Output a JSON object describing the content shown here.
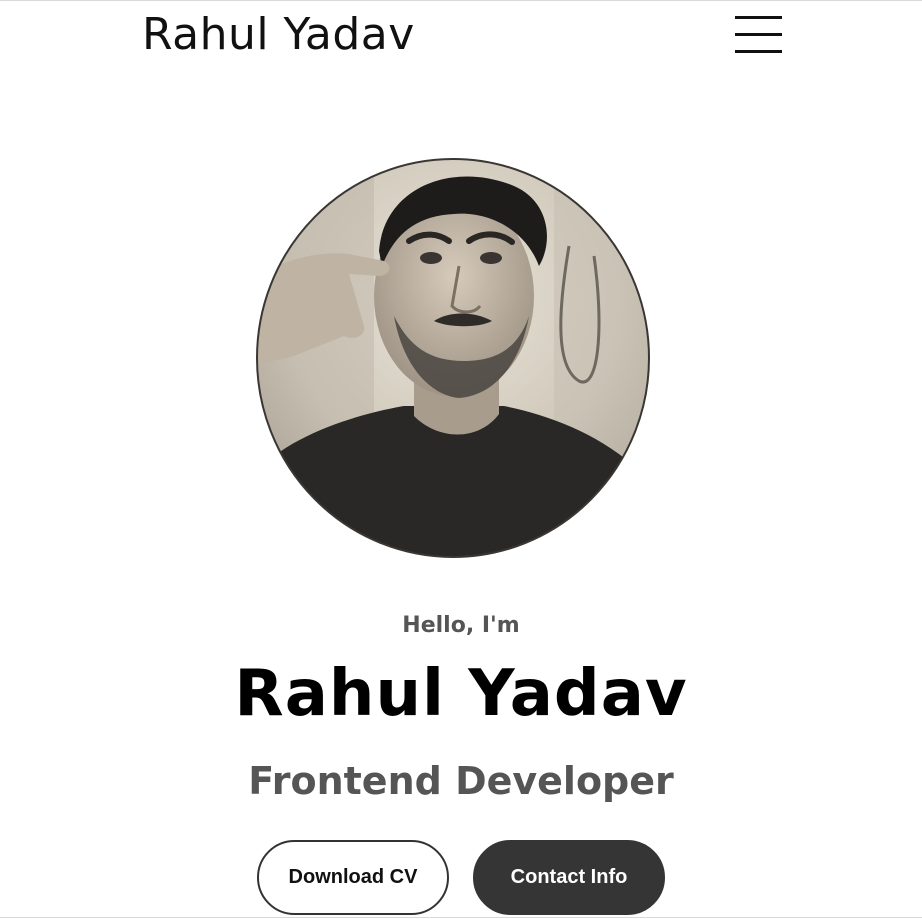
{
  "header": {
    "brand": "Rahul Yadav",
    "menu_icon": "hamburger-menu-icon"
  },
  "hero": {
    "photo_alt": "Profile photo of Rahul Yadav",
    "greeting": "Hello, I'm",
    "name": "Rahul Yadav",
    "role": "Frontend Developer"
  },
  "actions": {
    "download_label": "Download CV",
    "contact_label": "Contact Info"
  },
  "colors": {
    "text_dark": "#111111",
    "text_muted": "#555555",
    "button_dark": "#353535",
    "background": "#ffffff"
  }
}
